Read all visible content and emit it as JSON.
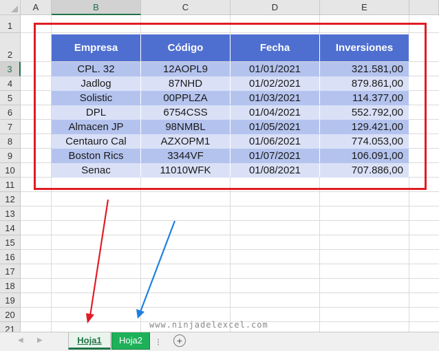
{
  "columns": [
    "A",
    "B",
    "C",
    "D",
    "E"
  ],
  "selected_column": "B",
  "rows": [
    "1",
    "2",
    "3",
    "4",
    "5",
    "6",
    "7",
    "8",
    "9",
    "10",
    "11",
    "12",
    "13",
    "14",
    "15",
    "16",
    "17",
    "18",
    "19",
    "20",
    "21"
  ],
  "selected_row": "3",
  "table": {
    "headers": [
      "Empresa",
      "Código",
      "Fecha",
      "Inversiones"
    ],
    "rows": [
      [
        "CPL. 32",
        "12AOPL9",
        "01/01/2021",
        "321.581,00"
      ],
      [
        "Jadlog",
        "87NHD",
        "01/02/2021",
        "879.861,00"
      ],
      [
        "Solistic",
        "00PPLZA",
        "01/03/2021",
        "114.377,00"
      ],
      [
        "DPL",
        "6754CSS",
        "01/04/2021",
        "552.792,00"
      ],
      [
        "Almacen JP",
        "98NMBL",
        "01/05/2021",
        "129.421,00"
      ],
      [
        "Centauro Cal",
        "AZXOPM1",
        "01/06/2021",
        "774.053,00"
      ],
      [
        "Boston Rics",
        "3344VF",
        "01/07/2021",
        "106.091,00"
      ],
      [
        "Senac",
        "11010WFK",
        "01/08/2021",
        "707.886,00"
      ]
    ]
  },
  "colors": {
    "header_bg": "#4f6fd0",
    "row_dark": "#b4c3ee",
    "row_light": "#dae1f7",
    "highlight_box": "#e01c24",
    "arrow_red": "#e01c24",
    "arrow_blue": "#1f7fe0",
    "active_tab": "#217346",
    "green_tab": "#1eb15a"
  },
  "sheet_tabs": {
    "tab1": "Hoja1",
    "tab2": "Hoja2",
    "add_icon": "+"
  },
  "watermark": "www.ninjadelexcel.com"
}
